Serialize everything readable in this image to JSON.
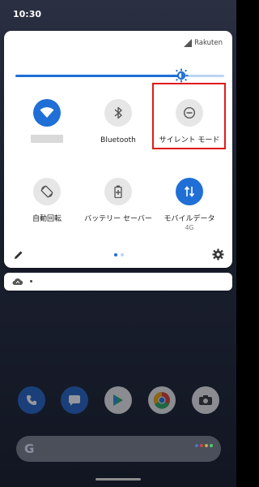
{
  "status_bar": {
    "time": "10:30"
  },
  "quick_settings": {
    "carrier": "Rakuten",
    "brightness": {
      "level": 0.8
    },
    "tiles": [
      {
        "id": "wifi",
        "label": "",
        "icon": "wifi-icon",
        "state": "on"
      },
      {
        "id": "bluetooth",
        "label": "Bluetooth",
        "icon": "bluetooth-icon",
        "state": "off"
      },
      {
        "id": "dnd",
        "label": "サイレント モード",
        "icon": "do-not-disturb-icon",
        "state": "off",
        "highlighted": true
      },
      {
        "id": "autorotate",
        "label": "自動回転",
        "icon": "rotate-icon",
        "state": "off"
      },
      {
        "id": "battery-saver",
        "label": "バッテリー セーバー",
        "icon": "battery-saver-icon",
        "state": "off"
      },
      {
        "id": "mobile-data",
        "label": "モバイルデータ",
        "sublabel": "4G",
        "icon": "mobile-data-icon",
        "state": "on"
      }
    ],
    "page_count": 2,
    "current_page": 1
  },
  "colors": {
    "accent": "#1f6fd6",
    "tile_off": "#e6e6e6",
    "highlight": "#e01a1a",
    "panel": "#ffffff"
  }
}
